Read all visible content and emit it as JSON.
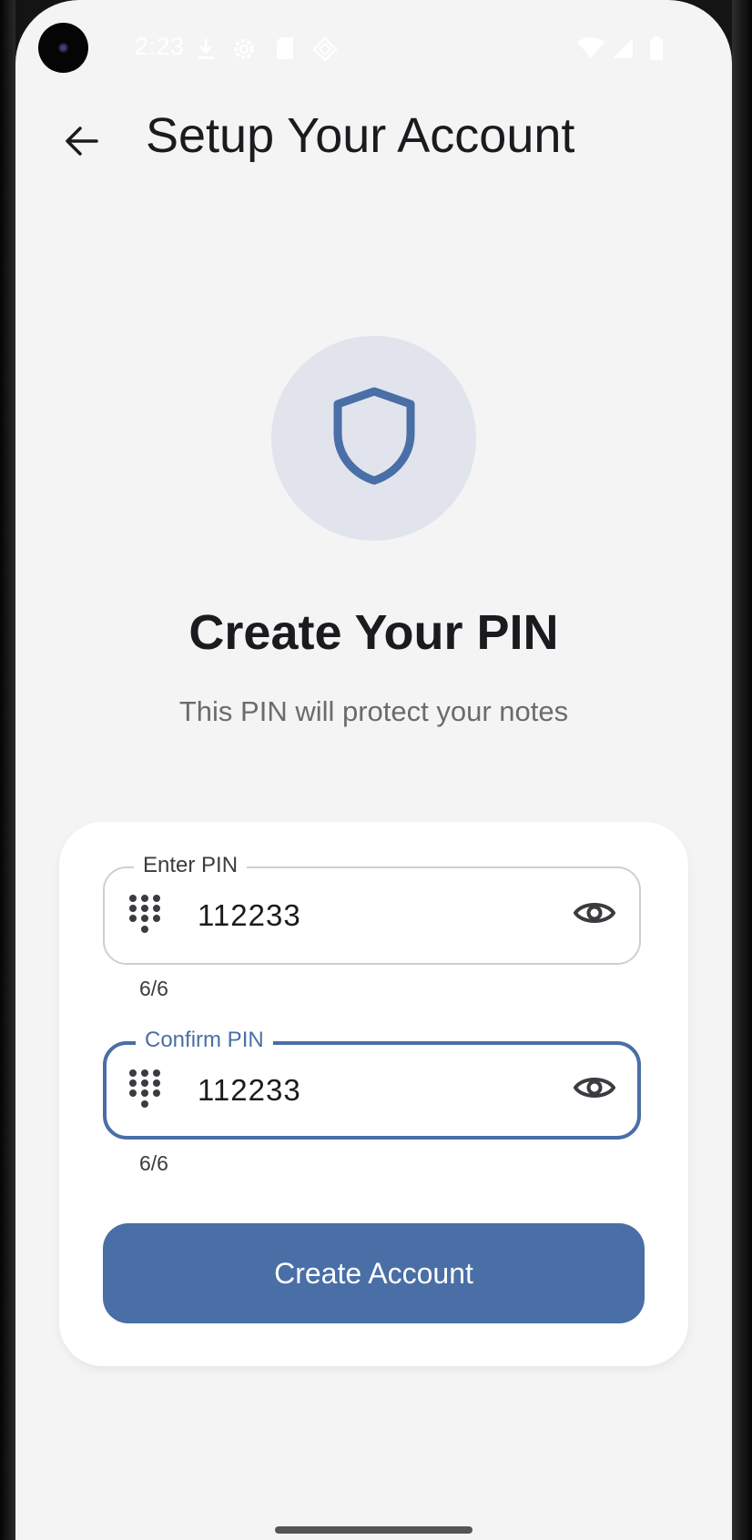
{
  "status_bar": {
    "time": "2:23",
    "left_icons": [
      "download-icon",
      "settings-icon",
      "sd-card-icon",
      "diamond-icon"
    ],
    "right_icons": [
      "wifi-icon",
      "signal-icon",
      "battery-icon"
    ]
  },
  "app_bar": {
    "back_icon": "arrow-back-icon",
    "title": "Setup Your Account"
  },
  "hero": {
    "icon": "shield-icon",
    "headline": "Create Your PIN",
    "subtitle": "This PIN will protect your notes"
  },
  "form": {
    "enter_pin": {
      "label": "Enter PIN",
      "value": "112233",
      "counter": "6/6",
      "leading_icon": "dialpad-icon",
      "trailing_icon": "eye-icon"
    },
    "confirm_pin": {
      "label": "Confirm PIN",
      "value": "112233",
      "counter": "6/6",
      "leading_icon": "dialpad-icon",
      "trailing_icon": "eye-icon"
    },
    "submit_label": "Create Account"
  },
  "colors": {
    "primary": "#4a6ea6",
    "background": "#f4f4f4",
    "card": "#ffffff",
    "shield_bg": "#e1e4ed"
  }
}
